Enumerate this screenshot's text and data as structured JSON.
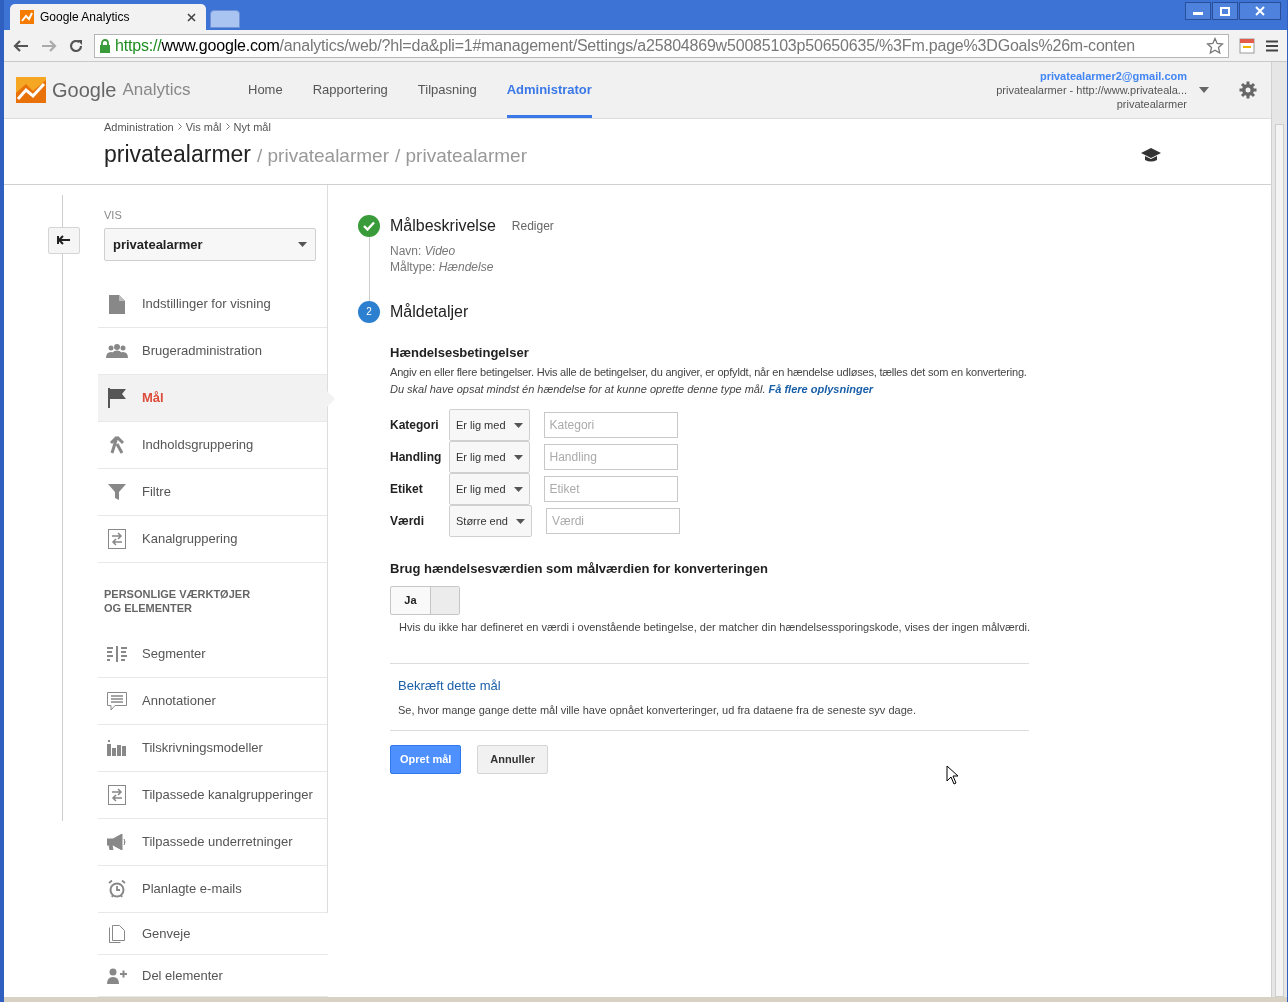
{
  "browser": {
    "tab_title": "Google Analytics",
    "url": {
      "scheme": "https://",
      "host": "www.google.com",
      "path": "/analytics/web/?hl=da&pli=1#management/Settings/a25804869w50085103p50650635/%3Fm.page%3DGoals%26m-conten"
    }
  },
  "header": {
    "logo": {
      "brand": "Google",
      "product": "Analytics"
    },
    "nav": [
      {
        "label": "Home",
        "selected": false
      },
      {
        "label": "Rapportering",
        "selected": false
      },
      {
        "label": "Tilpasning",
        "selected": false
      },
      {
        "label": "Administrator",
        "selected": true
      }
    ],
    "account": {
      "email": "privatealarmer2@gmail.com",
      "property": "privatealarmer - http://www.privateala...",
      "view": "privatealarmer"
    }
  },
  "page": {
    "breadcrumbs": [
      "Administration",
      "Vis mål",
      "Nyt mål"
    ],
    "title": "privatealarmer",
    "path": [
      "/ privatealarmer",
      "/ privatealarmer"
    ]
  },
  "sidebar": {
    "view_label": "VIS",
    "view_select": "privatealarmer",
    "items": [
      {
        "label": "Indstillinger for visning",
        "selected": false
      },
      {
        "label": "Brugeradministration",
        "selected": false
      },
      {
        "label": "Mål",
        "selected": true
      },
      {
        "label": "Indholdsgruppering",
        "selected": false
      },
      {
        "label": "Filtre",
        "selected": false
      },
      {
        "label": "Kanalgruppering",
        "selected": false
      }
    ],
    "section_title": "PERSONLIGE VÆRKTØJER OG ELEMENTER",
    "tools": [
      {
        "label": "Segmenter",
        "selected": false
      },
      {
        "label": "Annotationer",
        "selected": false
      },
      {
        "label": "Tilskrivningsmodeller",
        "selected": false
      },
      {
        "label": "Tilpassede kanalgrupperinger",
        "selected": false
      },
      {
        "label": "Tilpassede underretninger",
        "selected": false
      },
      {
        "label": "Planlagte e-mails",
        "selected": false
      },
      {
        "label": "Genveje",
        "selected": false
      },
      {
        "label": "Del elementer",
        "selected": false
      }
    ]
  },
  "steps": [
    {
      "completed": true,
      "title": "Målbeskrivelse",
      "edit": "Rediger",
      "fields": [
        {
          "label": "Navn:",
          "value": "Video"
        },
        {
          "label": "Måltype:",
          "value": "Hændelse"
        }
      ]
    },
    {
      "completed": false,
      "number": "2",
      "title": "Måldetaljer"
    }
  ],
  "conditions": {
    "title": "Hændelsesbetingelser",
    "description": "Angiv en eller flere betingelser. Hvis alle de betingelser, du angiver, er opfyldt, når en hændelse udløses, tælles det som en konvertering.",
    "note": "Du skal have opsat mindst én hændelse for at kunne oprette denne type mål.",
    "link": "Få flere oplysninger",
    "rows": [
      {
        "label": "Kategori",
        "operator": "Er lig med",
        "placeholder": "Kategori"
      },
      {
        "label": "Handling",
        "operator": "Er lig med",
        "placeholder": "Handling"
      },
      {
        "label": "Etiket",
        "operator": "Er lig med",
        "placeholder": "Etiket"
      },
      {
        "label": "Værdi",
        "operator": "Større end",
        "placeholder": "Værdi"
      }
    ]
  },
  "value_setting": {
    "title": "Brug hændelsesværdien som målværdien for konverteringen",
    "toggle": {
      "label": "Ja",
      "on": true
    },
    "hint": "Hvis du ikke har defineret en værdi i ovenstående betingelse, der matcher din hændelsessporingskode, vises der ingen målværdi."
  },
  "verify": {
    "link": "Bekræft dette mål",
    "description": "Se, hvor mange gange dette mål ville have opnået konverteringer, ud fra dataene fra de seneste syv dage."
  },
  "buttons": [
    {
      "label": "Opret mål",
      "kind": "primary"
    },
    {
      "label": "Annuller",
      "kind": "secondary"
    }
  ]
}
